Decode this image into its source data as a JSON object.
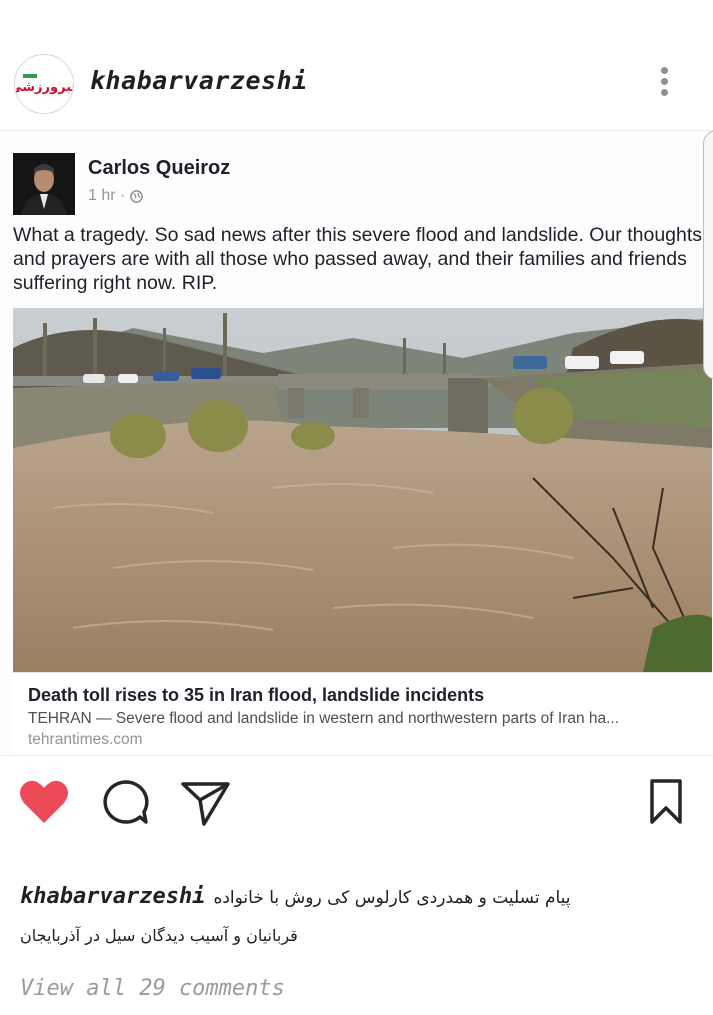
{
  "post": {
    "username": "khabarvarzeshi",
    "avatar_logo_text": "خبر ورزشی",
    "more_icon": "more-vertical-icon"
  },
  "embed": {
    "author": "Carlos Queiroz",
    "time": "1 hr ·",
    "privacy_icon": "globe-icon",
    "text": "What a tragedy. So sad news after this severe flood and landslide. Our thoughts and prayers are with all those who passed away, and their families and friends suffering right now. RIP.",
    "link": {
      "title": "Death toll rises to 35 in Iran flood, landslide incidents",
      "description": "TEHRAN — Severe flood and landslide in western and northwestern parts of Iran ha...",
      "domain": "tehrantimes.com"
    }
  },
  "actions": {
    "like_icon": "heart-icon",
    "like_color": "#ed4956",
    "comment_icon": "comment-icon",
    "share_icon": "send-icon",
    "save_icon": "bookmark-icon"
  },
  "caption": {
    "username": "khabarvarzeshi",
    "line1": "پیام تسلیت و همدردی کارلوس کی روش با خانواده",
    "line2": "قربانیان و آسیب دیدگان سیل در آذربایجان"
  },
  "comments_link": "View all 29 comments"
}
